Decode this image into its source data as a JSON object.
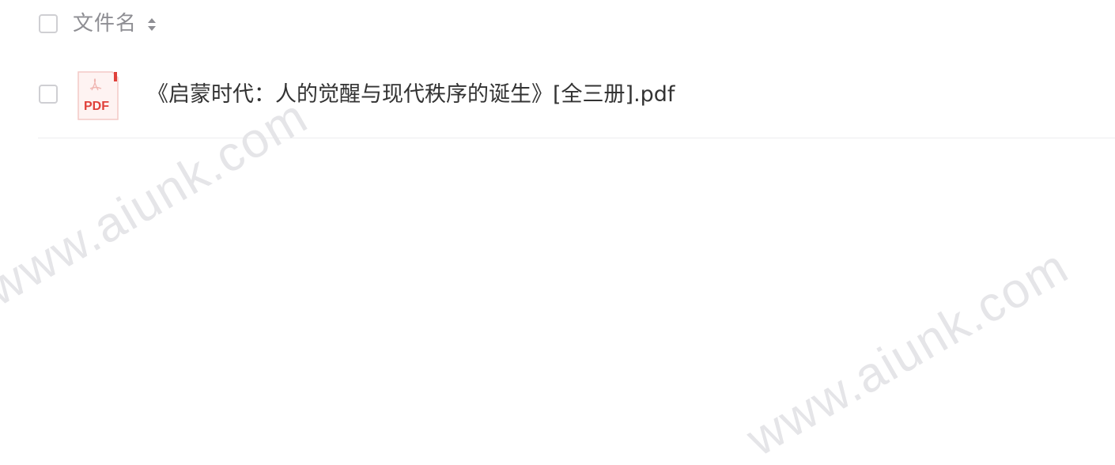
{
  "header": {
    "column_label": "文件名",
    "sort_icon": "sort-updown-icon"
  },
  "files": [
    {
      "type_icon": "pdf-file-icon",
      "icon_text": "PDF",
      "name": "《启蒙时代：人的觉醒与现代秩序的诞生》[全三册].pdf"
    }
  ],
  "watermark": {
    "text": "www.aiunk.com"
  },
  "colors": {
    "pdf_red": "#e0403a",
    "text": "#333333",
    "muted": "#8e8e93"
  }
}
